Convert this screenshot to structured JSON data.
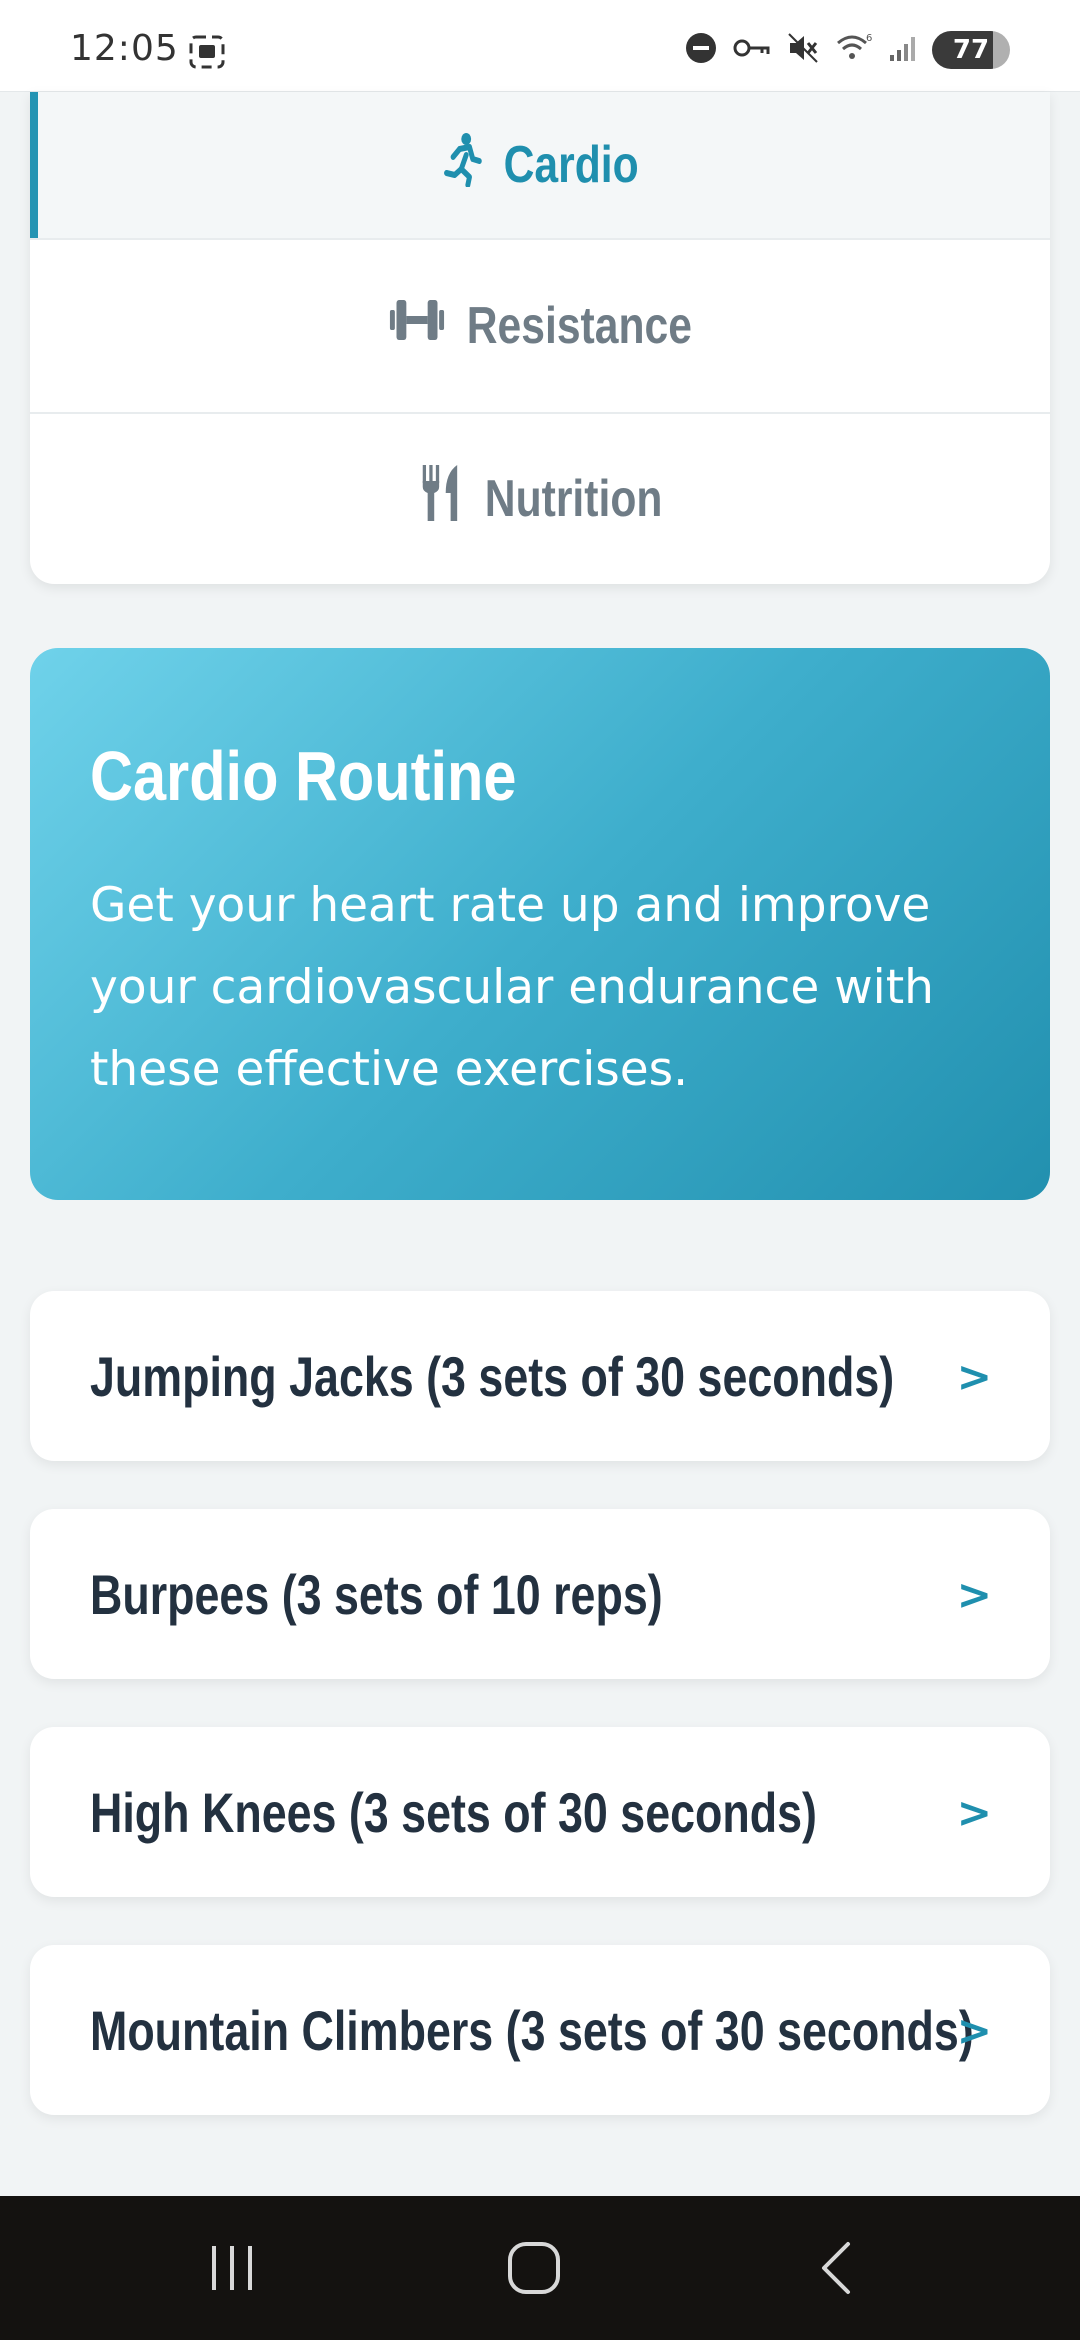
{
  "status_bar": {
    "time": "12:05",
    "battery": "77"
  },
  "tabs": [
    {
      "label": "Cardio",
      "icon": "running-icon",
      "active": true
    },
    {
      "label": "Resistance",
      "icon": "dumbbell-icon",
      "active": false
    },
    {
      "label": "Nutrition",
      "icon": "utensils-icon",
      "active": false
    }
  ],
  "hero": {
    "title": "Cardio Routine",
    "description": "Get your heart rate up and improve your cardiovascular endurance with these effective exercises."
  },
  "exercises": [
    {
      "label": "Jumping Jacks (3 sets of 30 seconds)",
      "arrow": ">"
    },
    {
      "label": "Burpees (3 sets of 10 reps)",
      "arrow": ">"
    },
    {
      "label": "High Knees (3 sets of 30 seconds)",
      "arrow": ">"
    },
    {
      "label": "Mountain Climbers (3 sets of 30 seconds)",
      "arrow": ">"
    }
  ],
  "colors": {
    "accent": "#1f8fae",
    "hero_start": "#6fd2ea",
    "hero_end": "#2290af",
    "text_dark": "#233140",
    "tab_inactive": "#6f7c86"
  }
}
